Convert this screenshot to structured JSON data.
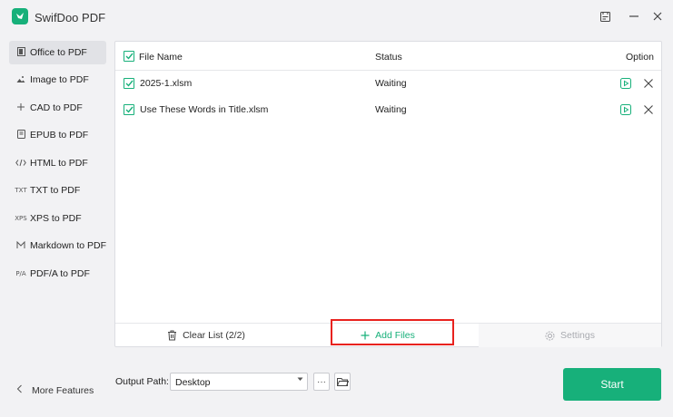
{
  "app": {
    "title": "SwifDoo PDF"
  },
  "sidebar": {
    "items": [
      {
        "icon": "office-icon",
        "label": "Office to PDF",
        "active": true
      },
      {
        "icon": "image-icon",
        "label": "Image to PDF"
      },
      {
        "icon": "cad-icon",
        "label": "CAD to PDF"
      },
      {
        "icon": "epub-icon",
        "label": "EPUB to PDF"
      },
      {
        "icon": "html-icon",
        "label": "HTML to PDF"
      },
      {
        "icon": "txt-icon",
        "label": "TXT to PDF",
        "icon_text": "TXT"
      },
      {
        "icon": "xps-icon",
        "label": "XPS to PDF",
        "icon_text": "XPS"
      },
      {
        "icon": "markdown-icon",
        "label": "Markdown to PDF"
      },
      {
        "icon": "pdfa-icon",
        "label": "PDF/A to PDF",
        "icon_text": "P/A"
      }
    ],
    "more_features": "More Features"
  },
  "table": {
    "headers": {
      "file_name": "File Name",
      "status": "Status",
      "option": "Option"
    },
    "rows": [
      {
        "file_name": "2025-1.xlsm",
        "status": "Waiting"
      },
      {
        "file_name": "Use These Words in Title.xlsm",
        "status": "Waiting"
      }
    ]
  },
  "actions": {
    "clear_list": "Clear List (2/2)",
    "add_files": "Add Files",
    "settings": "Settings"
  },
  "output": {
    "label": "Output Path:",
    "value": "Desktop",
    "more_label": "···"
  },
  "start_button": "Start",
  "colors": {
    "accent": "#17b07a",
    "highlight": "#e8221e",
    "disabled": "#a9abb0"
  }
}
